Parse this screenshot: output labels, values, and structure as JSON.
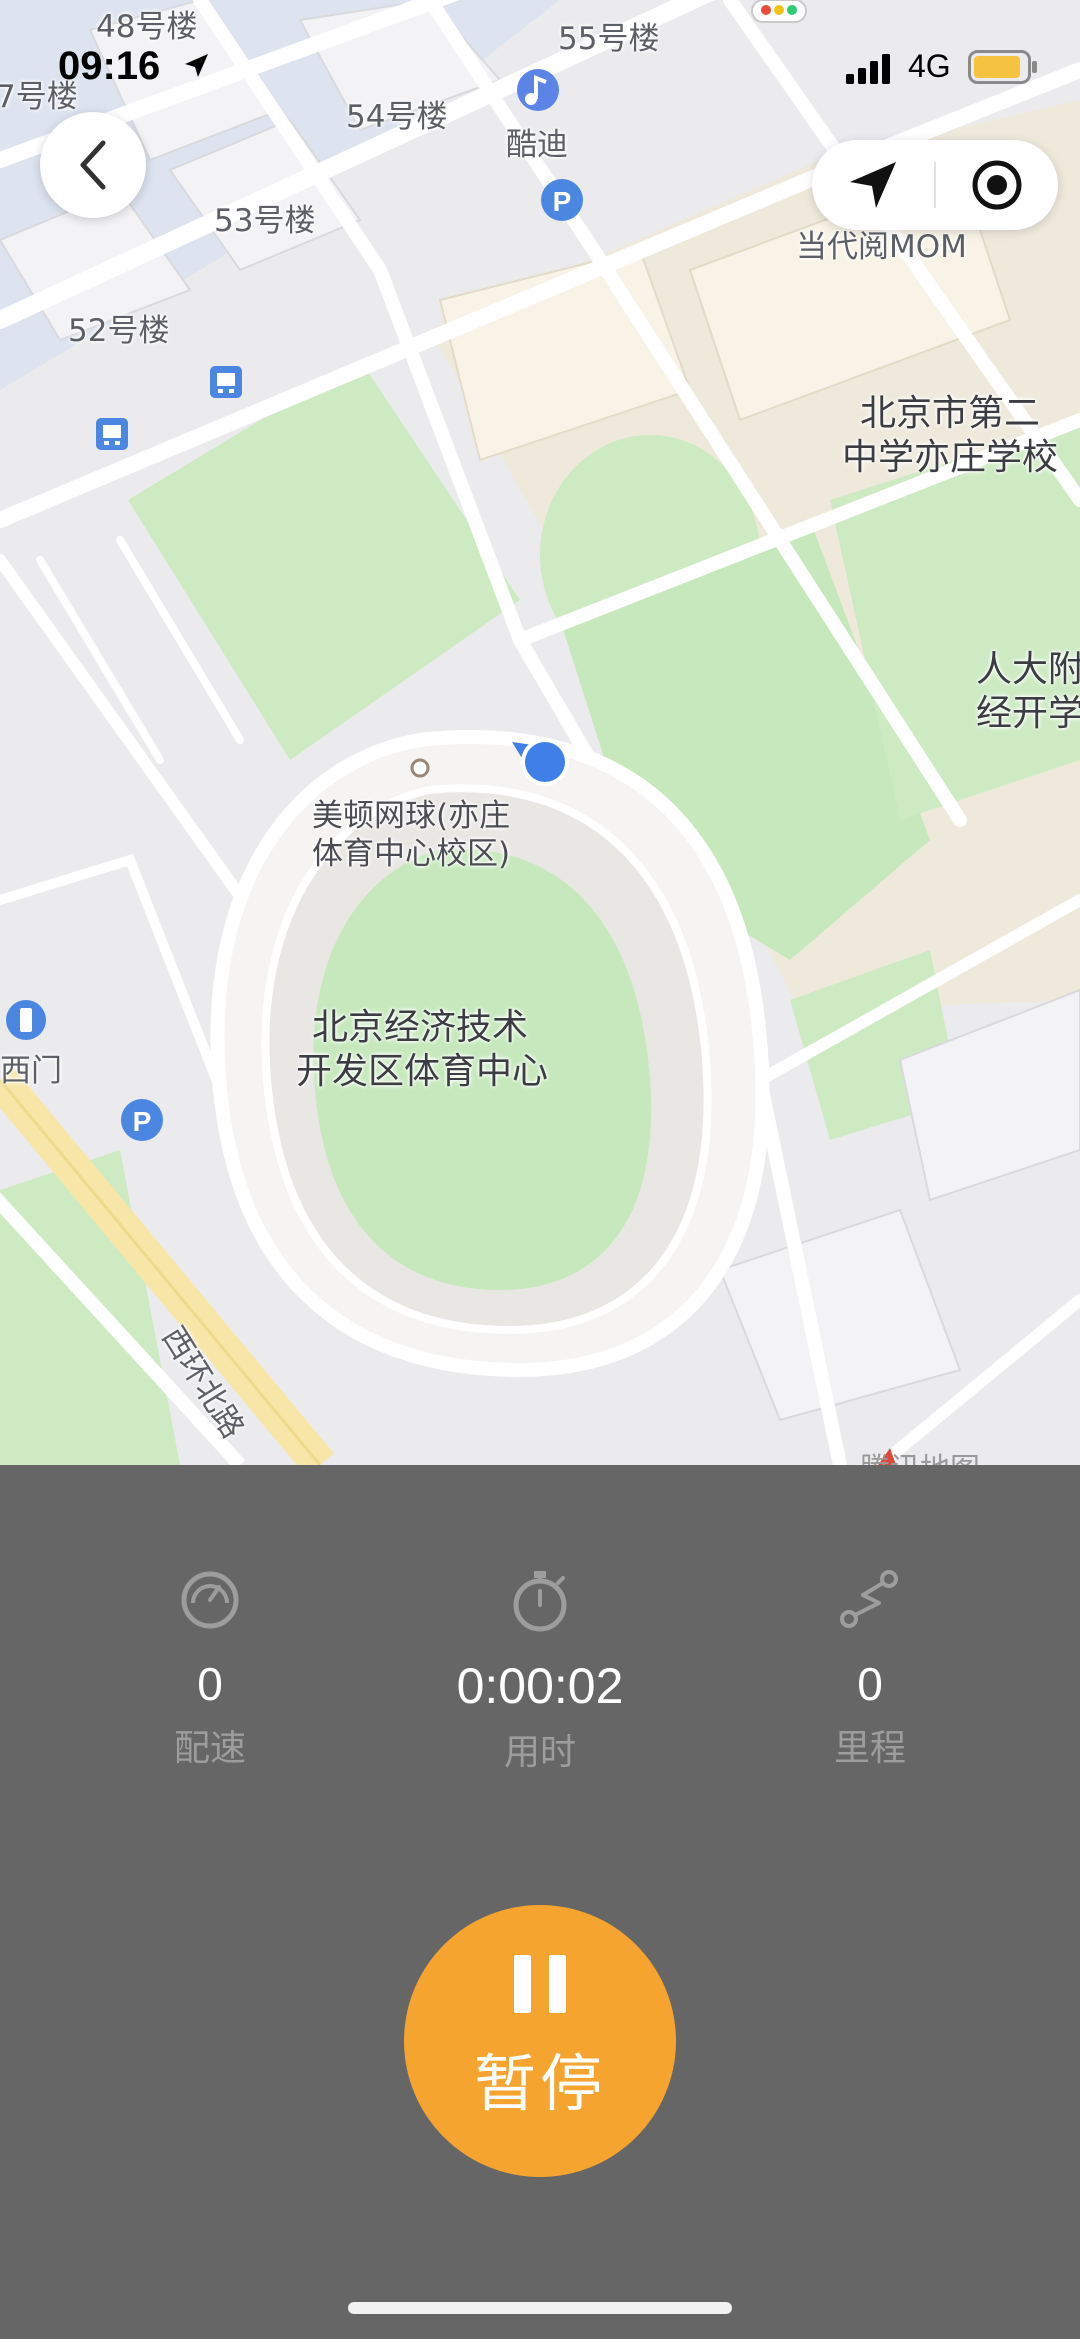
{
  "status_bar": {
    "time": "09:16",
    "network": "4G",
    "battery_color": "#f6c341"
  },
  "map": {
    "labels": {
      "bldg_48": "48号楼",
      "bldg_47": "7号楼",
      "bldg_55": "55号楼",
      "bldg_54": "54号楼",
      "bldg_53": "53号楼",
      "bldg_52": "52号楼",
      "kudi": "酷迪",
      "dangdai": "当代阅MOM",
      "school_1": "北京市第二",
      "school_2": "中学亦庄学校",
      "renda_1": "人大附",
      "renda_2": "经开学",
      "tennis_1": "美顿网球(亦庄",
      "tennis_2": "体育中心校区)",
      "stadium_1": "北京经济技术",
      "stadium_2": "开发区体育中心",
      "west_gate": "西门",
      "road": "西环北路",
      "watermark": "腾讯地图"
    },
    "icons": [
      "back-arrow",
      "navigation-arrow",
      "locate-target",
      "parking",
      "bus-stop",
      "music-poi",
      "user-location"
    ]
  },
  "stats": {
    "pace": {
      "value": "0",
      "label": "配速",
      "icon": "speedometer-icon"
    },
    "duration": {
      "value": "0:00:02",
      "label": "用时",
      "icon": "stopwatch-icon"
    },
    "distance": {
      "value": "0",
      "label": "里程",
      "icon": "route-icon"
    }
  },
  "controls": {
    "pause_label": "暂停",
    "pause_color": "#f5a430",
    "panel_color": "#666666"
  }
}
